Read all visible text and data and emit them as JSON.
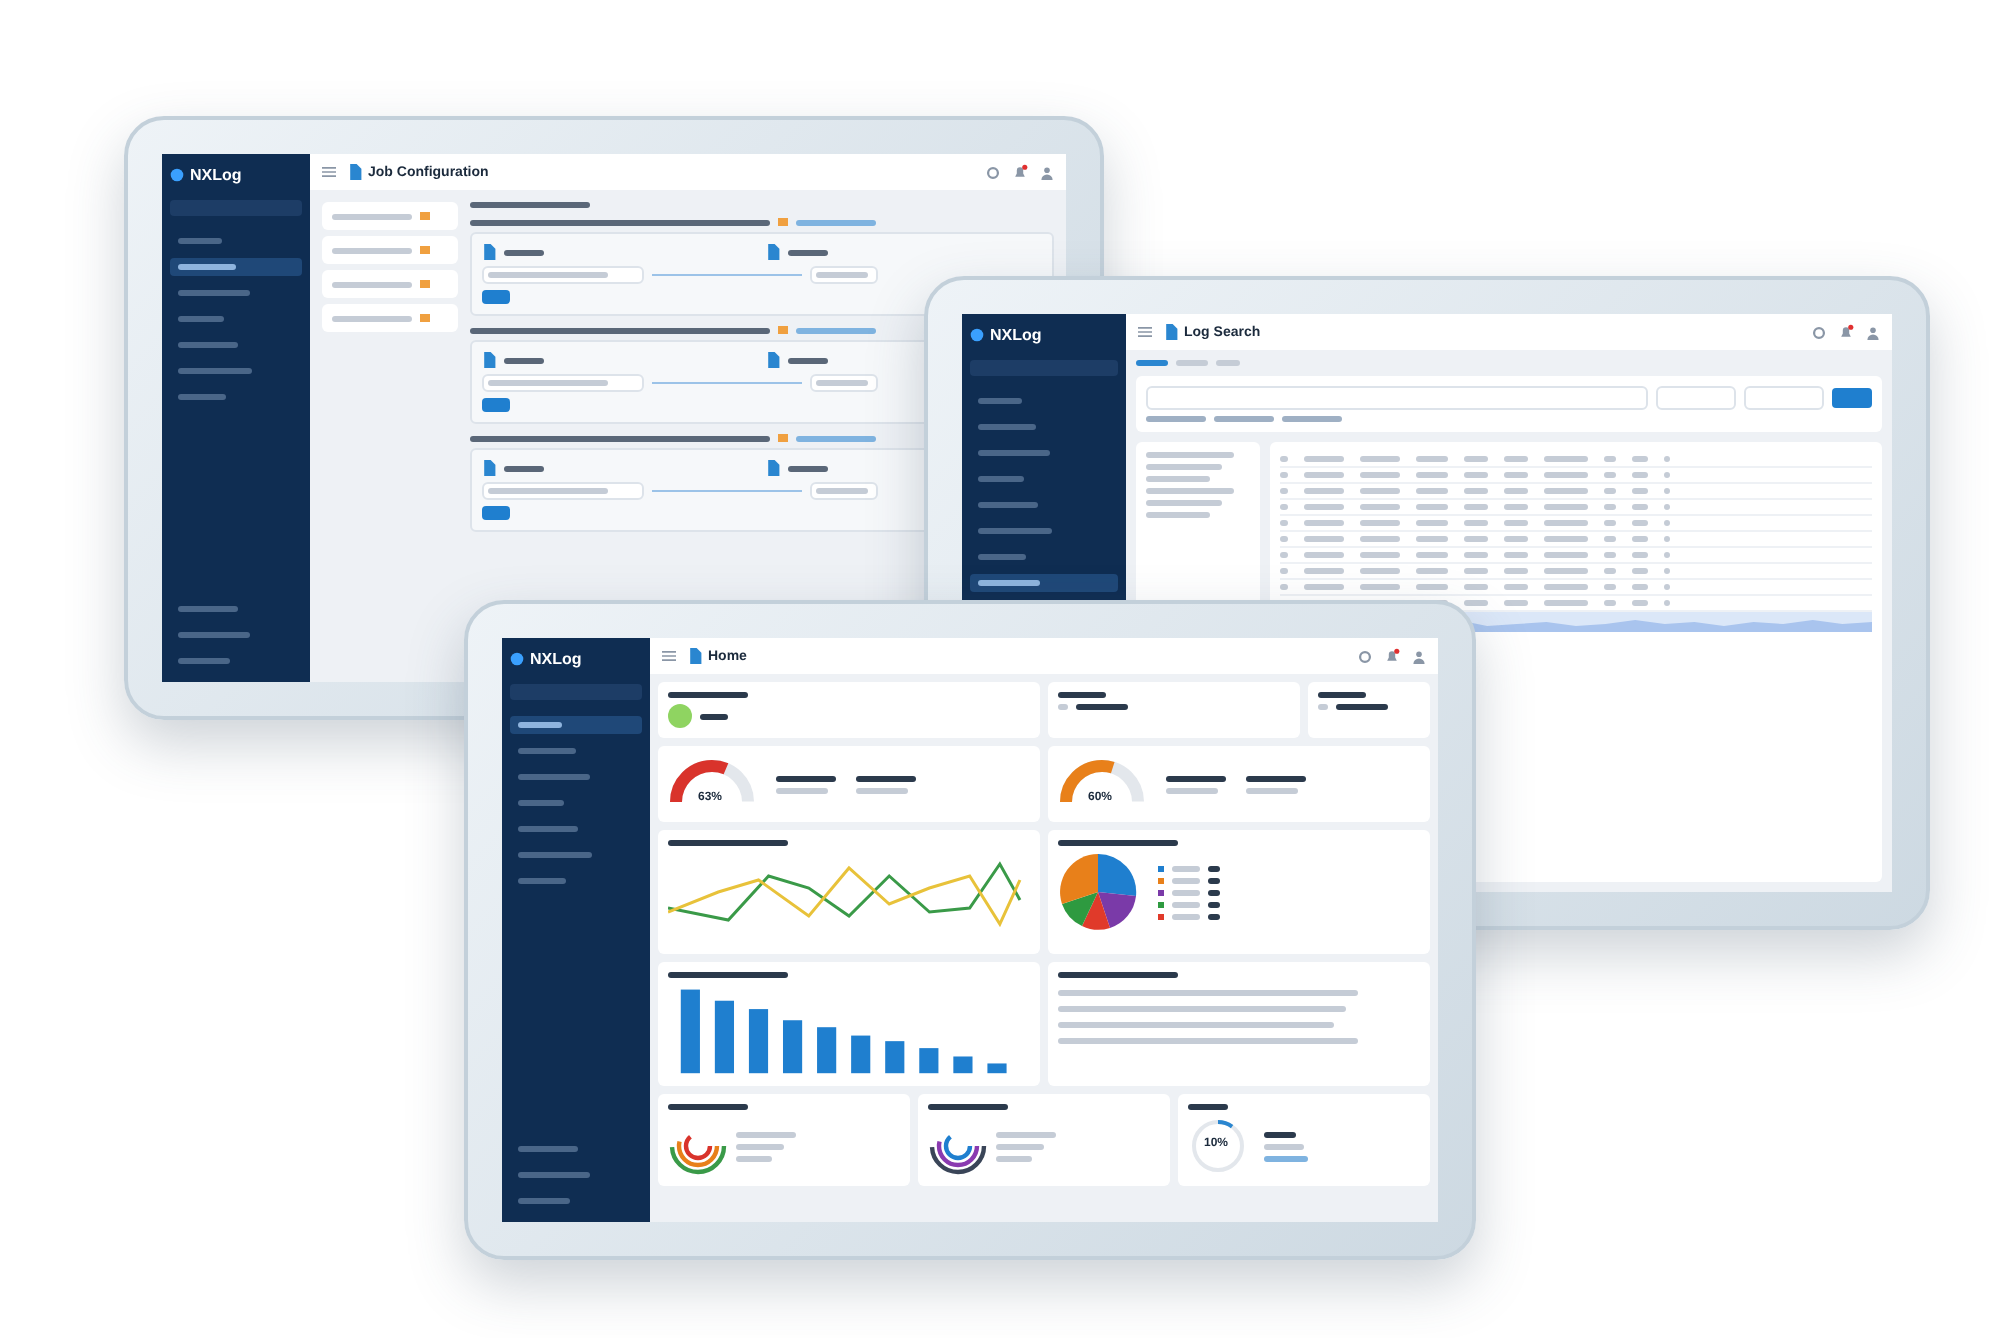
{
  "tablets": [
    {
      "kind": "config",
      "logo": "NXLog",
      "title": "Job Configuration",
      "nav": [
        {
          "selected": false
        },
        {
          "selected": true
        },
        {
          "selected": false
        },
        {
          "selected": false
        },
        {
          "selected": false
        },
        {
          "selected": false
        },
        {
          "selected": false
        }
      ]
    },
    {
      "kind": "search",
      "logo": "NXLog",
      "title": "Log Search",
      "nav": [
        {
          "selected": false
        },
        {
          "selected": false
        },
        {
          "selected": false
        },
        {
          "selected": false
        },
        {
          "selected": false
        },
        {
          "selected": false
        },
        {
          "selected": false
        },
        {
          "selected": true
        }
      ]
    },
    {
      "kind": "dashboard",
      "logo": "NXLog",
      "title": "Home",
      "nav": [
        {
          "selected": true
        },
        {
          "selected": false
        },
        {
          "selected": false
        },
        {
          "selected": false
        },
        {
          "selected": false
        },
        {
          "selected": false
        },
        {
          "selected": false
        }
      ],
      "gauges": [
        {
          "reading": "63%",
          "level": 0.63,
          "color": "#d9332b"
        },
        {
          "reading": "60%",
          "level": 0.6,
          "color": "#e8801a"
        }
      ],
      "quota": {
        "reading": "10%",
        "level": 0.1
      }
    }
  ]
}
